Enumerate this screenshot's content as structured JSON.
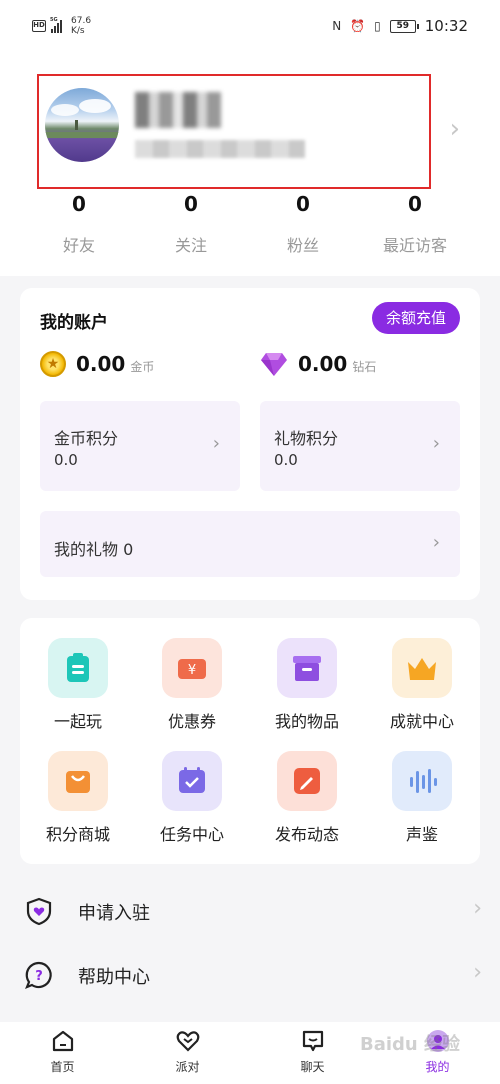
{
  "status_bar": {
    "hd": "HD",
    "network": "5G",
    "speed_value": "67.6",
    "speed_unit": "K/s",
    "battery": "59",
    "time": "10:32"
  },
  "profile": {
    "stats": [
      {
        "value": "0",
        "label": "好友"
      },
      {
        "value": "0",
        "label": "关注"
      },
      {
        "value": "0",
        "label": "粉丝"
      },
      {
        "value": "0",
        "label": "最近访客"
      }
    ]
  },
  "account": {
    "title": "我的账户",
    "recharge_label": "余额充值",
    "coins": {
      "amount": "0.00",
      "unit": "金币"
    },
    "diamonds": {
      "amount": "0.00",
      "unit": "钻石"
    },
    "coin_points": {
      "label": "金币积分",
      "value": "0.0"
    },
    "gift_points": {
      "label": "礼物积分",
      "value": "0.0"
    },
    "my_gifts": {
      "label": "我的礼物 0"
    }
  },
  "grid": [
    {
      "label": "一起玩",
      "icon": "clipboard-icon",
      "bg": "#d8f5f2",
      "fg": "#1ec6b8"
    },
    {
      "label": "优惠券",
      "icon": "coupon-icon",
      "bg": "#fde4dc",
      "fg": "#ef6b4a"
    },
    {
      "label": "我的物品",
      "icon": "box-icon",
      "bg": "#ece2fb",
      "fg": "#8e4ee0"
    },
    {
      "label": "成就中心",
      "icon": "crown-icon",
      "bg": "#fdefd8",
      "fg": "#f6a623"
    },
    {
      "label": "积分商城",
      "icon": "shopping-bag-icon",
      "bg": "#fde9d8",
      "fg": "#f39035"
    },
    {
      "label": "任务中心",
      "icon": "calendar-check-icon",
      "bg": "#e8e4fb",
      "fg": "#7b69e6"
    },
    {
      "label": "发布动态",
      "icon": "edit-icon",
      "bg": "#fde0d8",
      "fg": "#ee5d3f"
    },
    {
      "label": "声鉴",
      "icon": "sound-wave-icon",
      "bg": "#e1ebfb",
      "fg": "#6b95e6"
    }
  ],
  "list": [
    {
      "label": "申请入驻",
      "icon": "shield-heart-icon"
    },
    {
      "label": "帮助中心",
      "icon": "help-bubble-icon"
    }
  ],
  "nav": [
    {
      "label": "首页",
      "icon": "home-icon"
    },
    {
      "label": "派对",
      "icon": "heart-icon"
    },
    {
      "label": "聊天",
      "icon": "chat-icon"
    },
    {
      "label": "我的",
      "icon": "profile-icon"
    }
  ],
  "watermark": "Baidu 经验",
  "colors": {
    "accent": "#8a2be2",
    "highlight_box": "#e02a2a"
  }
}
